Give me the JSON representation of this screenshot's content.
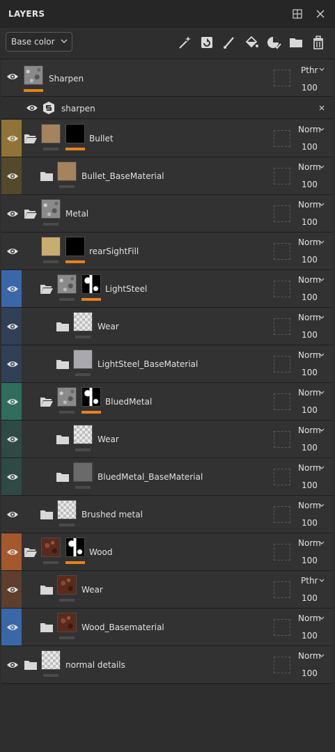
{
  "panel": {
    "title": "LAYERS"
  },
  "toolbar": {
    "channel": "Base color"
  },
  "effect": {
    "label": "sharpen"
  },
  "layers": [
    {
      "name": "Sharpen",
      "mode": "Pthr",
      "opacity": "100"
    },
    {
      "name": "Bullet",
      "mode": "Norm",
      "opacity": "100"
    },
    {
      "name": "Bullet_BaseMaterial",
      "mode": "Norm",
      "opacity": "100"
    },
    {
      "name": "Metal",
      "mode": "Norm",
      "opacity": "100"
    },
    {
      "name": "rearSightFill",
      "mode": "Norm",
      "opacity": "100"
    },
    {
      "name": "LightSteel",
      "mode": "Norm",
      "opacity": "100"
    },
    {
      "name": "Wear",
      "mode": "Norm",
      "opacity": "100"
    },
    {
      "name": "LightSteel_BaseMaterial",
      "mode": "Norm",
      "opacity": "100"
    },
    {
      "name": "BluedMetal",
      "mode": "Norm",
      "opacity": "100"
    },
    {
      "name": "Wear",
      "mode": "Norm",
      "opacity": "100"
    },
    {
      "name": "BluedMetal_BaseMaterial",
      "mode": "Norm",
      "opacity": "100"
    },
    {
      "name": "Brushed metal",
      "mode": "Norm",
      "opacity": "100"
    },
    {
      "name": "Wood",
      "mode": "Norm",
      "opacity": "100"
    },
    {
      "name": "Wear",
      "mode": "Pthr",
      "opacity": "100"
    },
    {
      "name": "Wood_Basematerial",
      "mode": "Norm",
      "opacity": "100"
    },
    {
      "name": "normal details",
      "mode": "Norm",
      "opacity": "100"
    }
  ],
  "colors": {
    "bullet": "#8f7435",
    "bullet_child": "#54492b",
    "lightsteel": "#3a67a8",
    "lightsteel_child": "#2f4057",
    "bluedmetal": "#2f6e5c",
    "bluedmetal_child": "#2e4a44",
    "wood": "#a4582c",
    "wood_wear": "#5e3e2c",
    "wood_base": "#3a67a8",
    "mask_indicator": "#e8821c"
  }
}
